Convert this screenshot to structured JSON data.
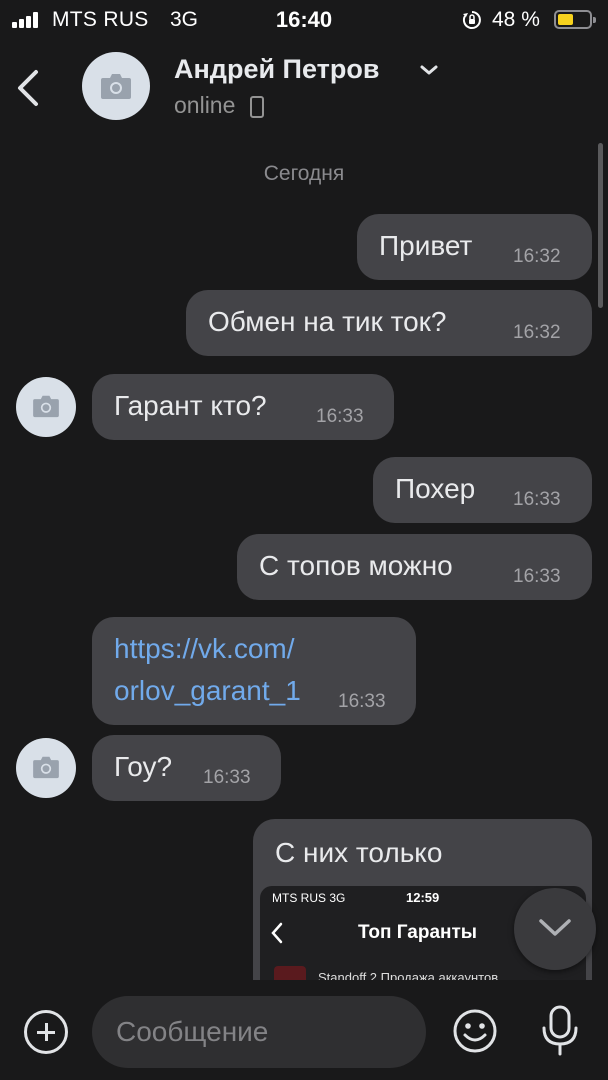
{
  "status_bar": {
    "carrier": "MTS RUS",
    "network": "3G",
    "time": "16:40",
    "battery_percent": "48 %",
    "battery_level": 0.48,
    "icons": [
      "signal-icon",
      "rotation-lock-icon",
      "battery-icon"
    ]
  },
  "header": {
    "name": "Андрей Петров",
    "status": "online",
    "icons": [
      "back-chevron-icon",
      "camera-icon",
      "chevron-down-icon",
      "phone-icon"
    ]
  },
  "chat": {
    "date_separator": "Сегодня",
    "messages": [
      {
        "direction": "out",
        "text": "Привет",
        "time": "16:32"
      },
      {
        "direction": "out",
        "text": "Обмен на тик ток?",
        "time": "16:32"
      },
      {
        "direction": "in",
        "text": "Гарант кто?",
        "time": "16:33"
      },
      {
        "direction": "out",
        "text": "Похер",
        "time": "16:33"
      },
      {
        "direction": "out",
        "text": "С топов можно",
        "time": "16:33"
      },
      {
        "direction": "in",
        "text_line1": "https://vk.com/",
        "text_line2": "orlov_garant_1",
        "time": "16:33"
      },
      {
        "direction": "in",
        "text": "Гоу?",
        "time": "16:33"
      },
      {
        "direction": "out",
        "text": "С них только"
      }
    ],
    "attachment": {
      "carrier": "MTS RUS  3G",
      "time": "12:59",
      "title": "Топ Гаранты",
      "item": "Standoff 2 Продажа аккаунтов"
    }
  },
  "composer": {
    "placeholder": "Сообщение",
    "icons": [
      "plus-icon",
      "emoji-icon",
      "microphone-icon"
    ]
  },
  "colors": {
    "background": "#19191a",
    "bubble": "#444448",
    "link": "#71aaeb",
    "battery": "#f7d21e"
  }
}
